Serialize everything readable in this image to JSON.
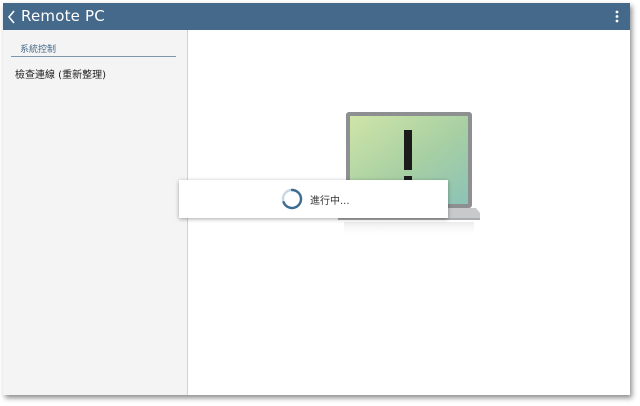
{
  "app": {
    "title": "Remote PC"
  },
  "sidebar": {
    "section_header": "系統控制",
    "items": [
      {
        "label": "檢查連線 (重新整理)"
      }
    ]
  },
  "dialog": {
    "message": "進行中..."
  },
  "colors": {
    "appbar": "#44698a",
    "accent": "#44698a",
    "sidebar_bg": "#f4f4f4",
    "spinner": "#3d6c91"
  },
  "icons": {
    "back": "chevron-left-icon",
    "menu": "overflow-menu-icon",
    "spinner": "loading-spinner-icon",
    "illustration": "laptop-alert-icon"
  }
}
